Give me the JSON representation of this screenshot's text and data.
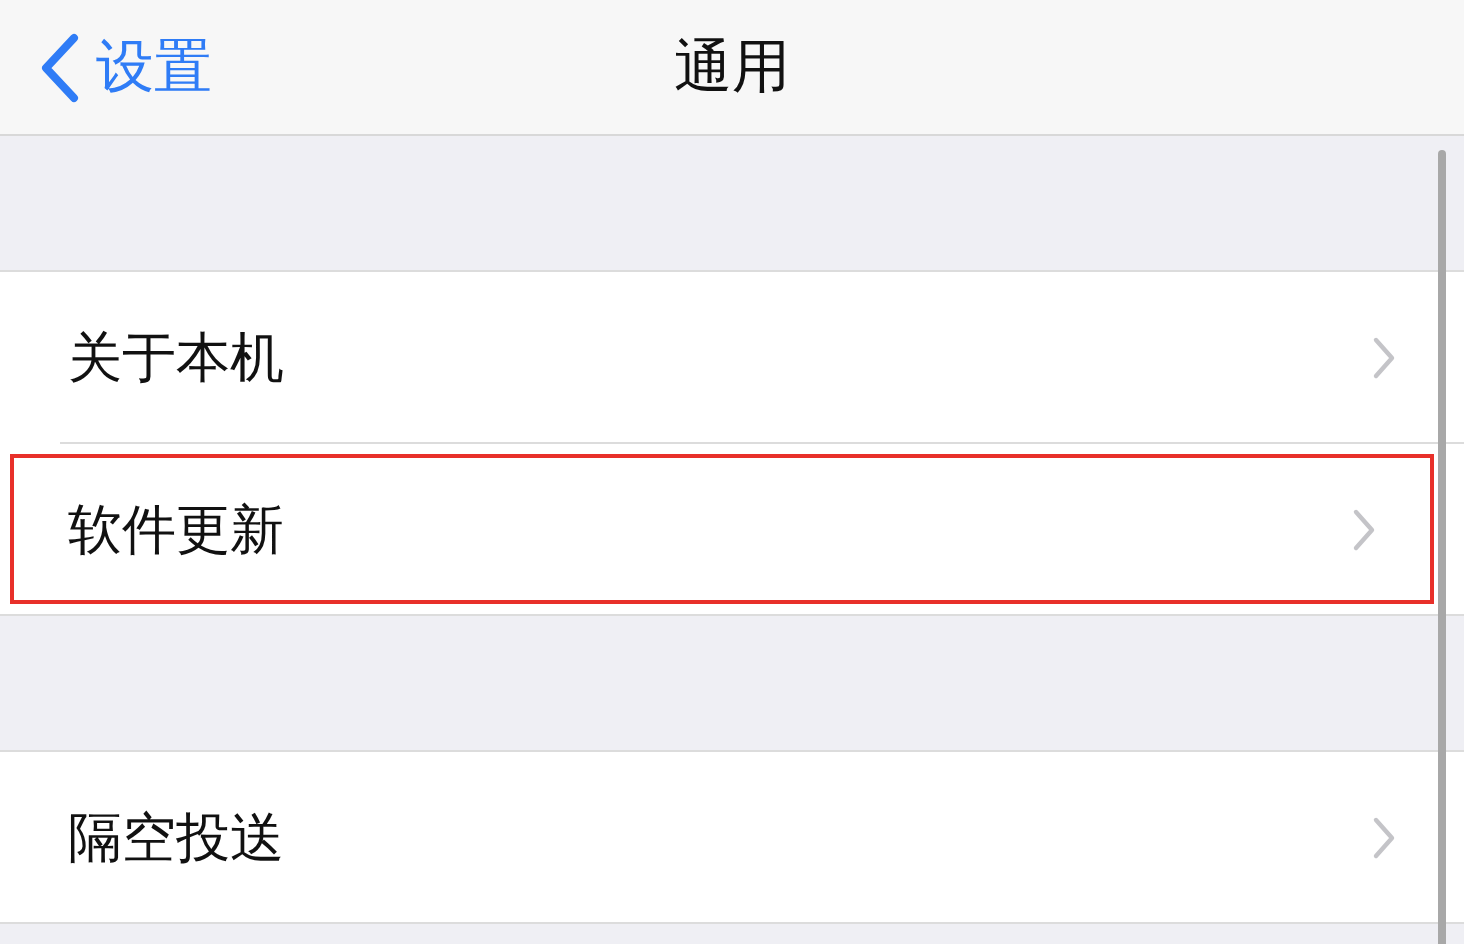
{
  "nav": {
    "back_label": "设置",
    "title": "通用"
  },
  "sections": [
    {
      "items": [
        {
          "label": "关于本机",
          "highlighted": false
        },
        {
          "label": "软件更新",
          "highlighted": true
        }
      ]
    },
    {
      "items": [
        {
          "label": "隔空投送",
          "highlighted": false
        }
      ]
    }
  ]
}
